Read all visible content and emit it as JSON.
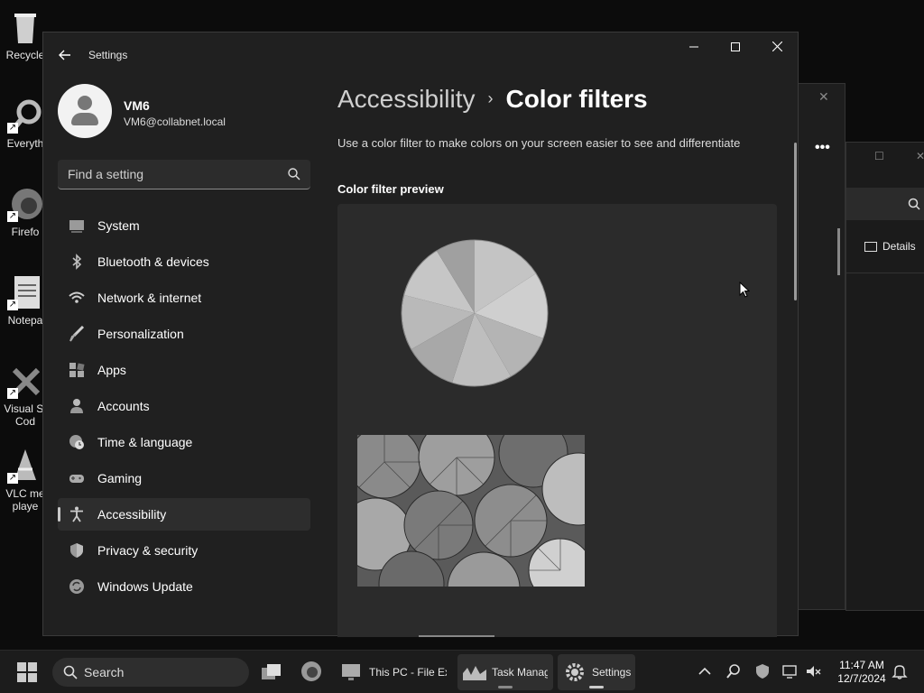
{
  "desktop": {
    "icons": [
      {
        "label": "Recycle",
        "icon": "recycle-bin-icon"
      },
      {
        "label": "Everyth",
        "icon": "everything-search-icon"
      },
      {
        "label": "Firefo",
        "icon": "firefox-icon"
      },
      {
        "label": "Notepa",
        "icon": "notepad-icon"
      },
      {
        "label": "Visual St\nCod",
        "icon": "vscode-icon"
      },
      {
        "label": "VLC me\nplaye",
        "icon": "vlc-icon"
      }
    ]
  },
  "background_window": {
    "details_label": "Details"
  },
  "settings": {
    "app_title": "Settings",
    "window_controls": {
      "minimize": "—",
      "maximize": "☐",
      "close": "✕"
    },
    "profile": {
      "name": "VM6",
      "email": "VM6@collabnet.local"
    },
    "search": {
      "placeholder": "Find a setting"
    },
    "nav": [
      {
        "label": "System",
        "icon": "system-icon",
        "active": false
      },
      {
        "label": "Bluetooth & devices",
        "icon": "bluetooth-icon",
        "active": false
      },
      {
        "label": "Network & internet",
        "icon": "wifi-icon",
        "active": false
      },
      {
        "label": "Personalization",
        "icon": "brush-icon",
        "active": false
      },
      {
        "label": "Apps",
        "icon": "apps-icon",
        "active": false
      },
      {
        "label": "Accounts",
        "icon": "person-icon",
        "active": false
      },
      {
        "label": "Time & language",
        "icon": "clock-globe-icon",
        "active": false
      },
      {
        "label": "Gaming",
        "icon": "gamepad-icon",
        "active": false
      },
      {
        "label": "Accessibility",
        "icon": "accessibility-icon",
        "active": true
      },
      {
        "label": "Privacy & security",
        "icon": "shield-icon",
        "active": false
      },
      {
        "label": "Windows Update",
        "icon": "update-icon",
        "active": false
      }
    ],
    "breadcrumb": {
      "parent": "Accessibility",
      "separator": "›",
      "current": "Color filters"
    },
    "description": "Use a color filter to make colors on your screen easier to see and differentiate",
    "preview_label": "Color filter preview"
  },
  "taskbar": {
    "search_label": "Search",
    "apps": [
      {
        "label": "This PC - File Exp",
        "icon": "monitor-icon",
        "active": false
      },
      {
        "label": "Task Manag",
        "icon": "task-manager-icon",
        "active": true
      },
      {
        "label": "Settings",
        "icon": "settings-gear-icon",
        "active": true
      }
    ],
    "clock": {
      "time": "11:47 AM",
      "date": "12/7/2024"
    }
  }
}
